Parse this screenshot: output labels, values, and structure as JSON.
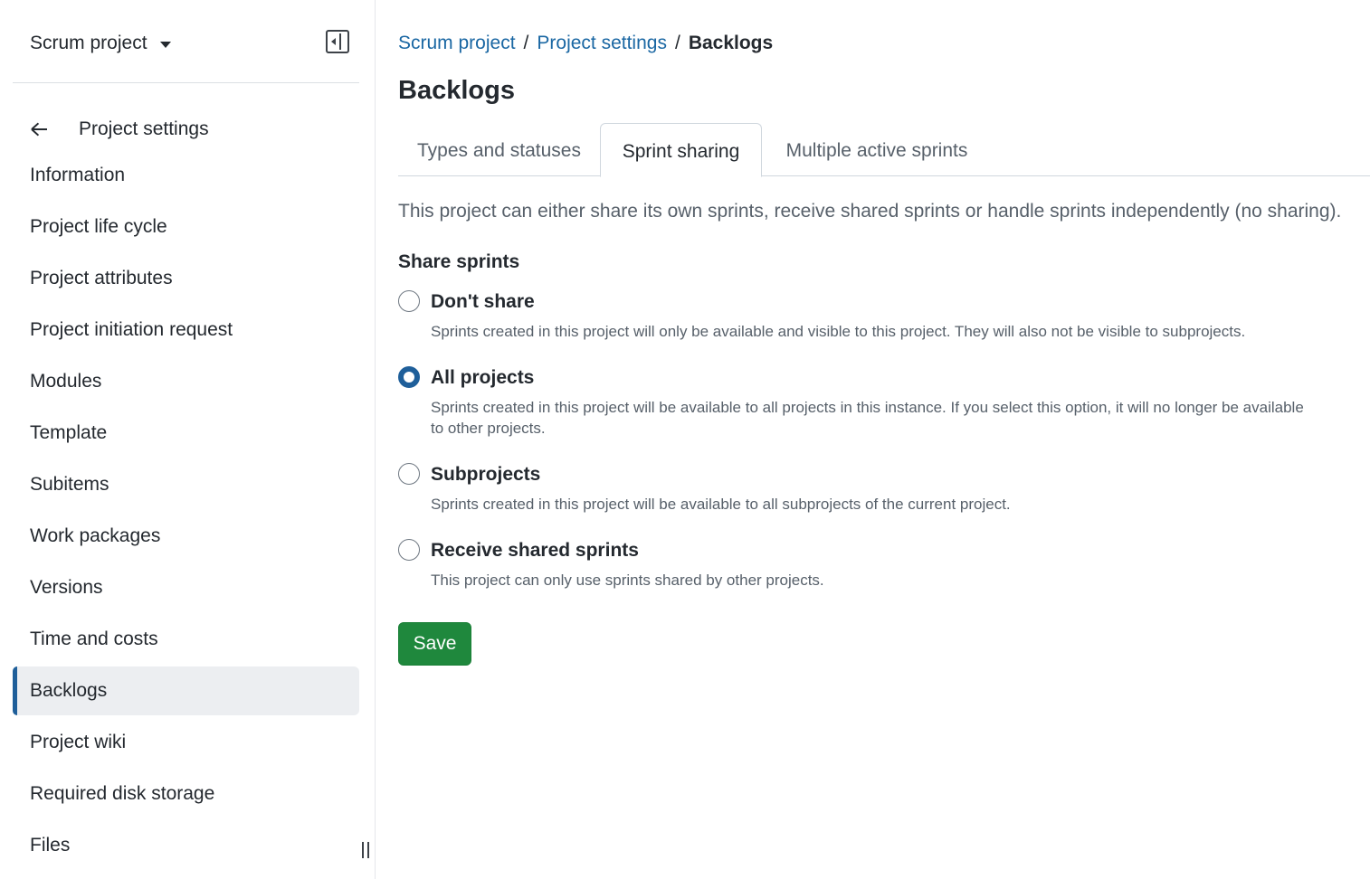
{
  "sidebar": {
    "project_name": "Scrum project",
    "back_label": "Project settings",
    "items": [
      {
        "label": "Information"
      },
      {
        "label": "Project life cycle"
      },
      {
        "label": "Project attributes"
      },
      {
        "label": "Project initiation request"
      },
      {
        "label": "Modules"
      },
      {
        "label": "Template"
      },
      {
        "label": "Subitems"
      },
      {
        "label": "Work packages"
      },
      {
        "label": "Versions"
      },
      {
        "label": "Time and costs"
      },
      {
        "label": "Backlogs",
        "active": true
      },
      {
        "label": "Project wiki"
      },
      {
        "label": "Required disk storage"
      },
      {
        "label": "Files"
      }
    ]
  },
  "breadcrumb": {
    "items": [
      "Scrum project",
      "Project settings"
    ],
    "separator": "/",
    "current": "Backlogs"
  },
  "page": {
    "title": "Backlogs",
    "tabs": [
      {
        "label": "Types and statuses"
      },
      {
        "label": "Sprint sharing",
        "active": true
      },
      {
        "label": "Multiple active sprints"
      }
    ],
    "intro": "This project can either share its own sprints, receive shared sprints or handle sprints independently (no sharing).",
    "section_title": "Share sprints",
    "options": [
      {
        "label": "Don't share",
        "description": "Sprints created in this project will only be available and visible to this project. They will also not be visible to subprojects.",
        "checked": false
      },
      {
        "label": "All projects",
        "description": "Sprints created in this project will be available to all projects in this instance. If you select this option, it will no longer be available to other projects.",
        "checked": true
      },
      {
        "label": "Subprojects",
        "description": "Sprints created in this project will be available to all subprojects of the current project.",
        "checked": false
      },
      {
        "label": "Receive shared sprints",
        "description": "This project can only use sprints shared by other projects.",
        "checked": false
      }
    ],
    "save_label": "Save"
  },
  "colors": {
    "accent": "#1f5f9a",
    "link": "#1a67a3",
    "primary_button": "#1f883d"
  }
}
